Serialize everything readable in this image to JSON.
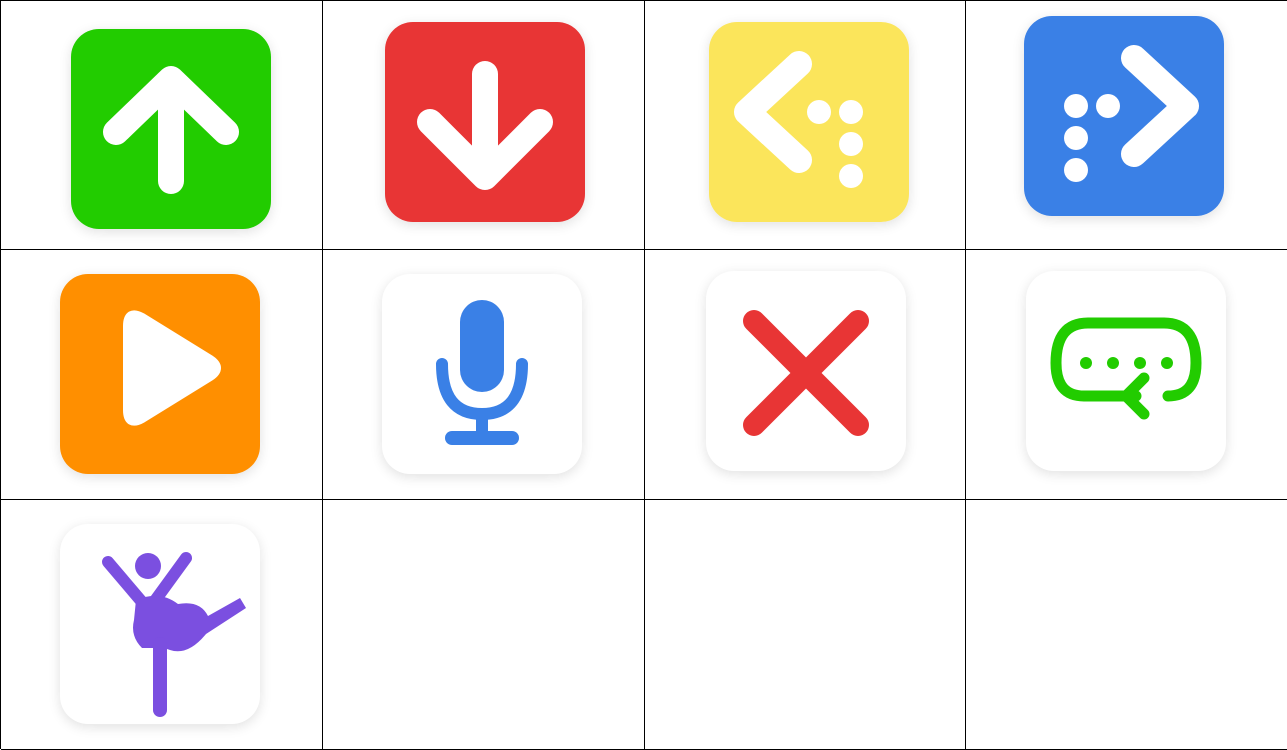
{
  "tiles": [
    {
      "icon": "arrow-up-icon",
      "background": "#22cc00",
      "foreground": "#ffffff"
    },
    {
      "icon": "arrow-down-icon",
      "background": "#e83535",
      "foreground": "#ffffff"
    },
    {
      "icon": "dotted-arrow-left-icon",
      "background": "#fbe55b",
      "foreground": "#ffffff"
    },
    {
      "icon": "dotted-arrow-right-icon",
      "background": "#3a80e6",
      "foreground": "#ffffff"
    },
    {
      "icon": "play-icon",
      "background": "#ff8f00",
      "foreground": "#ffffff"
    },
    {
      "icon": "microphone-icon",
      "background": "#ffffff",
      "foreground": "#3a80e6"
    },
    {
      "icon": "close-x-icon",
      "background": "#ffffff",
      "foreground": "#e83535"
    },
    {
      "icon": "loop-repeat-icon",
      "background": "#ffffff",
      "foreground": "#22cc00"
    },
    {
      "icon": "dancer-icon",
      "background": "#ffffff",
      "foreground": "#7b4fe0"
    }
  ]
}
